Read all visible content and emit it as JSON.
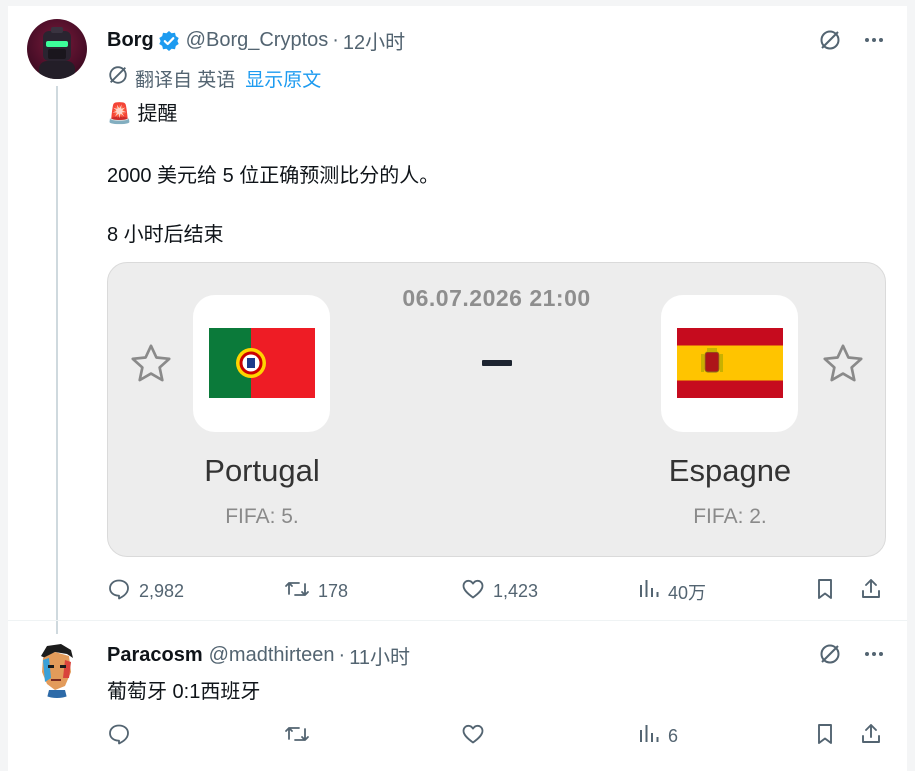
{
  "tweet1": {
    "name": "Borg",
    "handle": "@Borg_Cryptos",
    "separator": "·",
    "time": "12小时",
    "translated_label": "翻译自 英语",
    "show_original": "显示原文",
    "line1_emoji": "🚨",
    "line1": "提醒",
    "line2": "2000 美元给 5 位正确预测比分的人。",
    "line3": "8 小时后结束",
    "card": {
      "datetime": "06.07.2026 21:00",
      "home_team": "Portugal",
      "home_rank": "FIFA: 5.",
      "away_team": "Espagne",
      "away_rank": "FIFA: 2."
    },
    "stats": {
      "replies": "2,982",
      "reposts": "178",
      "likes": "1,423",
      "views": "40万"
    }
  },
  "tweet2": {
    "name": "Paracosm",
    "handle": "@madthirteen",
    "separator": "·",
    "time": "11小时",
    "text": "葡萄牙 0:1西班牙",
    "stats": {
      "views": "6"
    }
  },
  "colors": {
    "accent": "#1d9bf0",
    "text_secondary": "#536471",
    "card_bg": "#ededed",
    "thread_line": "#cfd9de"
  },
  "icons": [
    "verified-badge-icon",
    "grok-icon",
    "more-icon",
    "translate-icon",
    "siren-emoji",
    "star-icon",
    "reply-icon",
    "repost-icon",
    "like-icon",
    "views-icon",
    "bookmark-icon",
    "share-icon"
  ]
}
